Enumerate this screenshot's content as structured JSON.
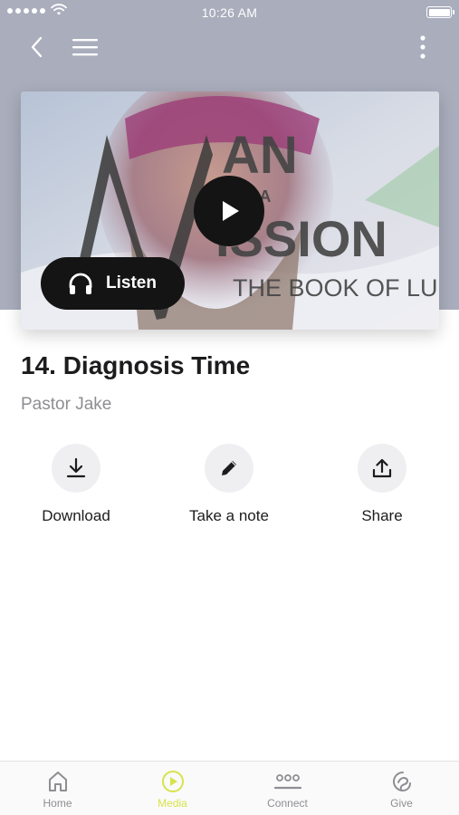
{
  "status_bar": {
    "time": "10:26 AM"
  },
  "media": {
    "artwork": {
      "title_line_1": "AN",
      "title_on_a": "ON A",
      "title_line_2": "ISSION",
      "subtitle": "THE BOOK OF LUKE"
    },
    "listen_label": "Listen",
    "title": "14. Diagnosis Time",
    "speaker": "Pastor Jake"
  },
  "actions": [
    {
      "label": "Download",
      "icon": "download-icon"
    },
    {
      "label": "Take a note",
      "icon": "pencil-icon"
    },
    {
      "label": "Share",
      "icon": "share-icon"
    }
  ],
  "tabs": [
    {
      "label": "Home",
      "icon": "home-icon",
      "active": false
    },
    {
      "label": "Media",
      "icon": "play-circle-icon",
      "active": true
    },
    {
      "label": "Connect",
      "icon": "people-icon",
      "active": false
    },
    {
      "label": "Give",
      "icon": "give-icon",
      "active": false
    }
  ],
  "colors": {
    "header_bg": "#a9adbc",
    "accent": "#d7e34a",
    "text": "#1c1c1e",
    "muted": "#8e8e93"
  }
}
